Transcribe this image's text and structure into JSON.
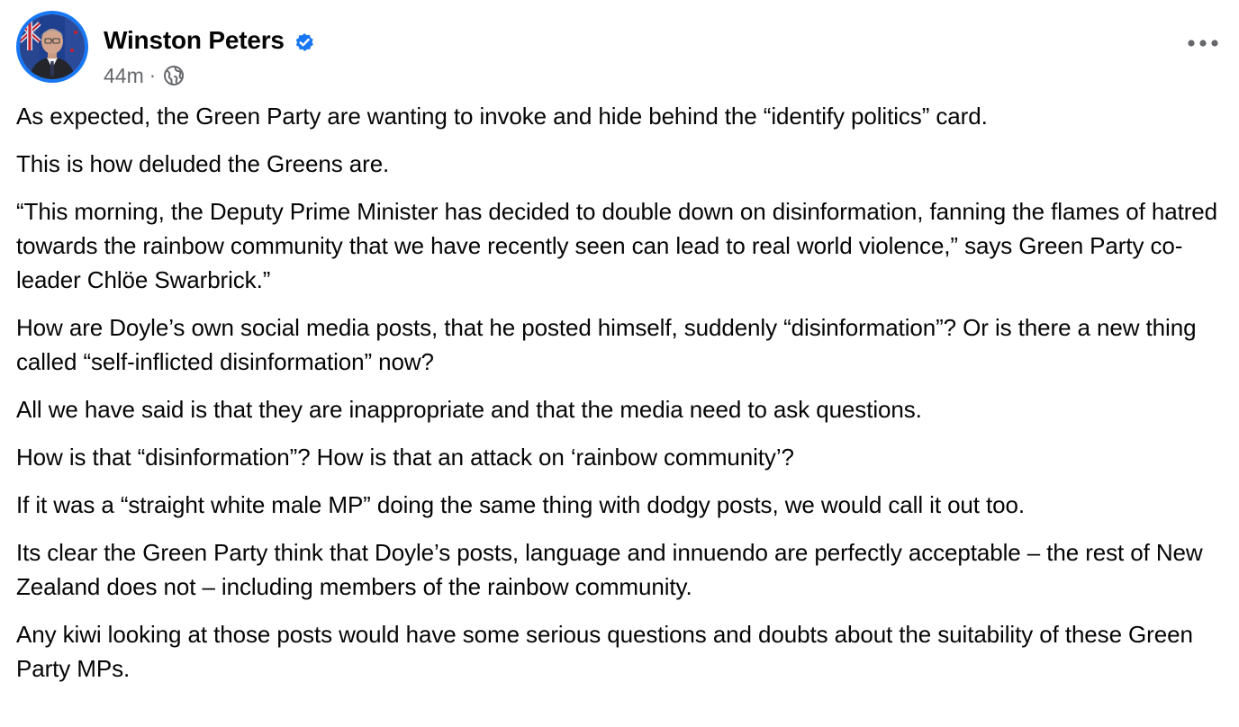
{
  "post": {
    "author": {
      "name": "Winston Peters",
      "verified": true,
      "avatar_icon": "profile-photo"
    },
    "meta": {
      "timestamp": "44m",
      "separator": "·",
      "audience_icon": "globe-icon"
    },
    "more_icon": "more-horizontal-icon",
    "paragraphs": [
      "As expected, the Green Party are wanting to invoke and hide behind the “identify politics” card.",
      "This is how deluded the Greens are.",
      "“This morning, the Deputy Prime Minister has decided to double down on disinformation, fanning the flames of hatred towards the rainbow community that we have recently seen can lead to real world violence,” says Green Party co-leader Chlöe Swarbrick.”",
      "How are Doyle’s own social media posts, that he posted himself, suddenly “disinformation”? Or is there a new thing called “self-inflicted disinformation” now?",
      "All we have said is that they are inappropriate and that the media need to ask questions.",
      "How is that “disinformation”? How is that an attack on ‘rainbow community’?",
      "If it was a “straight white male MP” doing the same thing with dodgy posts, we would call it out too.",
      "Its clear the Green Party think that Doyle’s posts, language and innuendo are perfectly acceptable – the rest of New Zealand does not – including members of the rainbow community.",
      "Any kiwi looking at those posts would have some serious questions and doubts about the suitability of these Green Party MPs."
    ]
  },
  "colors": {
    "accent": "#1877f2",
    "text_primary": "#050505",
    "text_secondary": "#65676b"
  }
}
